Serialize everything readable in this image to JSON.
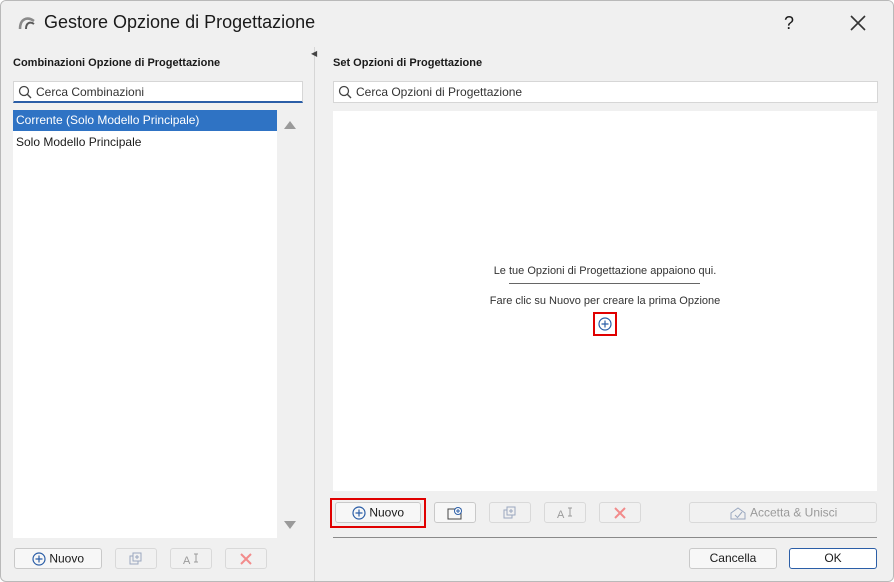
{
  "window": {
    "title": "Gestore Opzione di Progettazione",
    "help": "?"
  },
  "left": {
    "heading": "Combinazioni Opzione di Progettazione",
    "search_placeholder": "Cerca Combinazioni",
    "items": [
      {
        "label": "Corrente (Solo Modello Principale)",
        "selected": true
      },
      {
        "label": "Solo Modello Principale",
        "selected": false
      }
    ],
    "toolbar": {
      "new_label": "Nuovo"
    }
  },
  "right": {
    "heading": "Set Opzioni di Progettazione",
    "search_placeholder": "Cerca Opzioni di Progettazione",
    "empty_title": "Le tue Opzioni di Progettazione appaiono qui.",
    "empty_hint": "Fare clic su Nuovo per creare la prima Opzione",
    "toolbar": {
      "new_label": "Nuovo",
      "accept_merge_label": "Accetta & Unisci"
    }
  },
  "footer": {
    "cancel_label": "Cancella",
    "ok_label": "OK"
  },
  "colors": {
    "accent": "#2f73c4",
    "highlight": "#e00000",
    "disabled_red": "#f28b8b"
  },
  "icons": [
    "app-logo-icon",
    "close-icon",
    "search-icon",
    "collapse-left-icon",
    "add-icon",
    "new-folder-icon",
    "duplicate-icon",
    "rename-icon",
    "delete-icon",
    "accept-merge-icon",
    "scroll-up-icon",
    "scroll-down-icon"
  ]
}
